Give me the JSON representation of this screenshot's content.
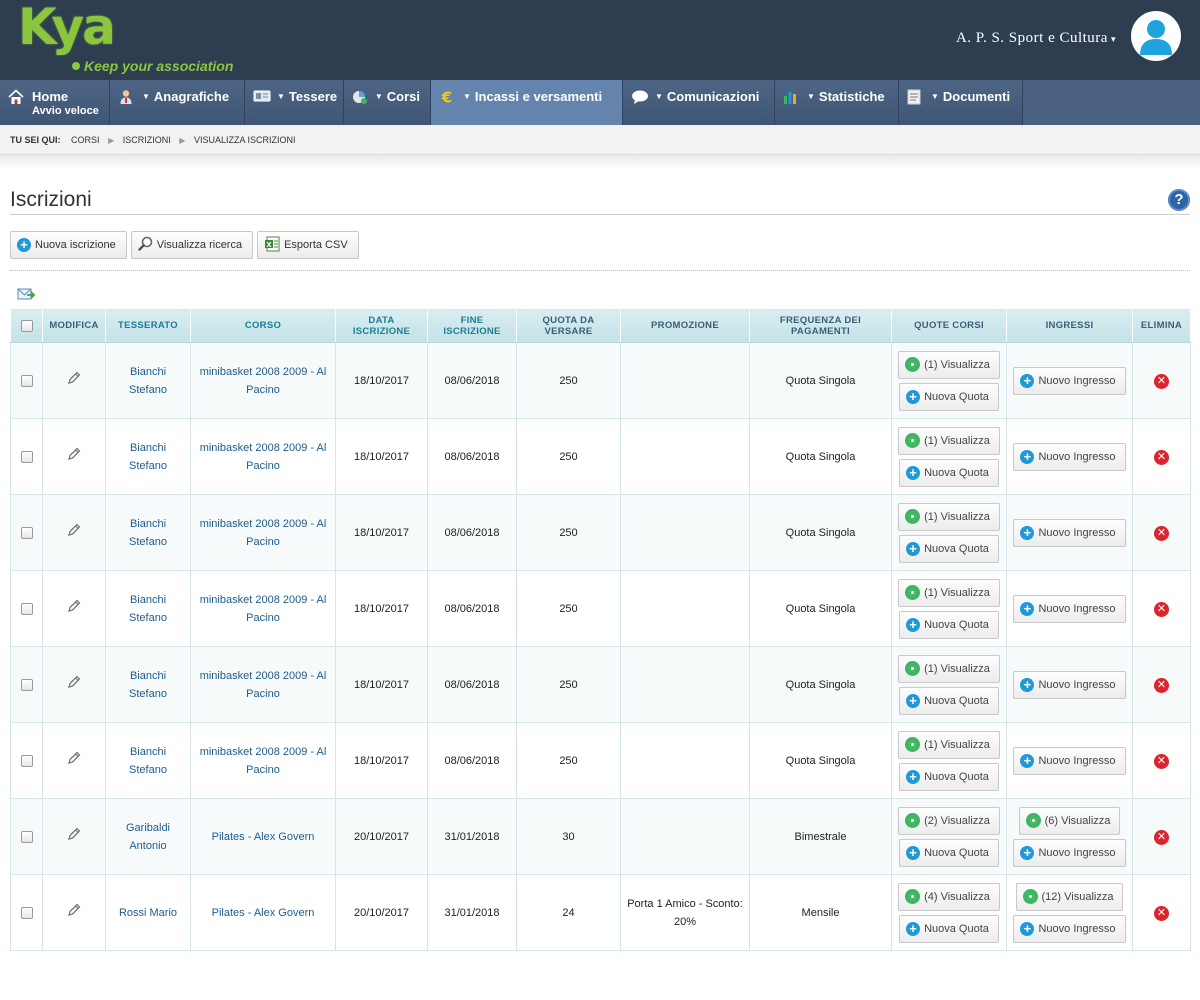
{
  "header": {
    "logo_text": "Kya",
    "logo_tagline": "Keep your association",
    "org_name": "A. P. S. Sport e Cultura",
    "org_caret": "▾"
  },
  "nav": {
    "items": [
      {
        "label": "Home",
        "sublabel": "Avvio veloce",
        "icon": "home-icon",
        "has_dropdown": false
      },
      {
        "label": "Anagrafiche",
        "icon": "person-icon",
        "has_dropdown": true
      },
      {
        "label": "Tessere",
        "icon": "card-icon",
        "has_dropdown": true
      },
      {
        "label": "Corsi",
        "icon": "courses-icon",
        "has_dropdown": true
      },
      {
        "label": "Incassi e versamenti",
        "icon": "euro-icon",
        "has_dropdown": true,
        "active": true
      },
      {
        "label": "Comunicazioni",
        "icon": "speech-bubble-icon",
        "has_dropdown": true
      },
      {
        "label": "Statistiche",
        "icon": "bar-chart-icon",
        "has_dropdown": true
      },
      {
        "label": "Documenti",
        "icon": "document-icon",
        "has_dropdown": true
      }
    ]
  },
  "breadcrumb": {
    "label": "Tu sei qui:",
    "items": [
      "Corsi",
      "Iscrizioni",
      "Visualizza iscrizioni"
    ]
  },
  "page": {
    "title": "Iscrizioni",
    "help": "?"
  },
  "toolbar": {
    "new_label": "Nuova iscrizione",
    "search_label": "Visualizza ricerca",
    "export_label": "Esporta CSV"
  },
  "table": {
    "columns": [
      "",
      "Modifica",
      "Tesserato",
      "Corso",
      "Data iscrizione",
      "Fine iscrizione",
      "Quota da versare",
      "Promozione",
      "Frequenza dei pagamenti",
      "Quote corsi",
      "Ingressi",
      "Elimina"
    ],
    "rows": [
      {
        "tesserato": "Bianchi Stefano",
        "corso": "minibasket 2008 2009 - Al Pacino",
        "data": "18/10/2017",
        "fine": "08/06/2018",
        "quota": "250",
        "promo": "",
        "freq": "Quota Singola",
        "quote_vis": "(1) Visualizza",
        "ingressi_vis": ""
      },
      {
        "tesserato": "Bianchi Stefano",
        "corso": "minibasket 2008 2009 - Al Pacino",
        "data": "18/10/2017",
        "fine": "08/06/2018",
        "quota": "250",
        "promo": "",
        "freq": "Quota Singola",
        "quote_vis": "(1) Visualizza",
        "ingressi_vis": ""
      },
      {
        "tesserato": "Bianchi Stefano",
        "corso": "minibasket 2008 2009 - Al Pacino",
        "data": "18/10/2017",
        "fine": "08/06/2018",
        "quota": "250",
        "promo": "",
        "freq": "Quota Singola",
        "quote_vis": "(1) Visualizza",
        "ingressi_vis": ""
      },
      {
        "tesserato": "Bianchi Stefano",
        "corso": "minibasket 2008 2009 - Al Pacino",
        "data": "18/10/2017",
        "fine": "08/06/2018",
        "quota": "250",
        "promo": "",
        "freq": "Quota Singola",
        "quote_vis": "(1) Visualizza",
        "ingressi_vis": ""
      },
      {
        "tesserato": "Bianchi Stefano",
        "corso": "minibasket 2008 2009 - Al Pacino",
        "data": "18/10/2017",
        "fine": "08/06/2018",
        "quota": "250",
        "promo": "",
        "freq": "Quota Singola",
        "quote_vis": "(1) Visualizza",
        "ingressi_vis": ""
      },
      {
        "tesserato": "Bianchi Stefano",
        "corso": "minibasket 2008 2009 - Al Pacino",
        "data": "18/10/2017",
        "fine": "08/06/2018",
        "quota": "250",
        "promo": "",
        "freq": "Quota Singola",
        "quote_vis": "(1) Visualizza",
        "ingressi_vis": ""
      },
      {
        "tesserato": "Garibaldi Antonio",
        "corso": "Pilates - Alex Govern",
        "data": "20/10/2017",
        "fine": "31/01/2018",
        "quota": "30",
        "promo": "",
        "freq": "Bimestrale",
        "quote_vis": "(2) Visualizza",
        "ingressi_vis": "(6) Visualizza"
      },
      {
        "tesserato": "Rossi Mario",
        "corso": "Pilates - Alex Govern",
        "data": "20/10/2017",
        "fine": "31/01/2018",
        "quota": "24",
        "promo": "Porta 1 Amico - Sconto: 20%",
        "freq": "Mensile",
        "quote_vis": "(4) Visualizza",
        "ingressi_vis": "(12) Visualizza"
      }
    ],
    "new_quota_label": "Nuova Quota",
    "new_ingresso_label": "Nuovo Ingresso"
  },
  "colors": {
    "header_bg": "#2e3d50",
    "nav_bg": "#4a6080",
    "nav_active": "#6584ad",
    "logo_green": "#8cc63f",
    "link_blue": "#1f5c8c"
  }
}
